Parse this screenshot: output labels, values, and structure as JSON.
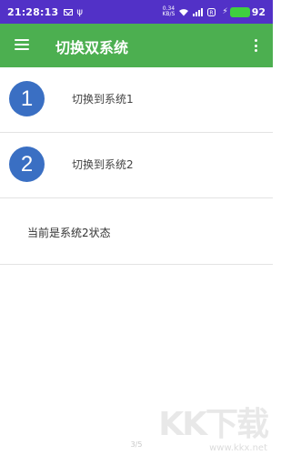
{
  "status_bar": {
    "time": "21:28:13",
    "speed_value": "0.34",
    "speed_unit": "KB/S",
    "battery": "92",
    "colors": {
      "background": "#5231c7",
      "battery": "#3fcf3f"
    }
  },
  "app_bar": {
    "title": "切换双系统",
    "menu_icon": "menu-icon",
    "overflow_icon": "more-vert-icon",
    "color": "#4caf50"
  },
  "systems": [
    {
      "number": "1",
      "label": "切换到系统1"
    },
    {
      "number": "2",
      "label": "切换到系统2"
    }
  ],
  "current_status": "当前是系统2状态",
  "page_indicator": "3/5",
  "watermark": {
    "logo": "KK下载",
    "url": "www.kkx.net"
  },
  "accent_circle_color": "#3a6fc3"
}
